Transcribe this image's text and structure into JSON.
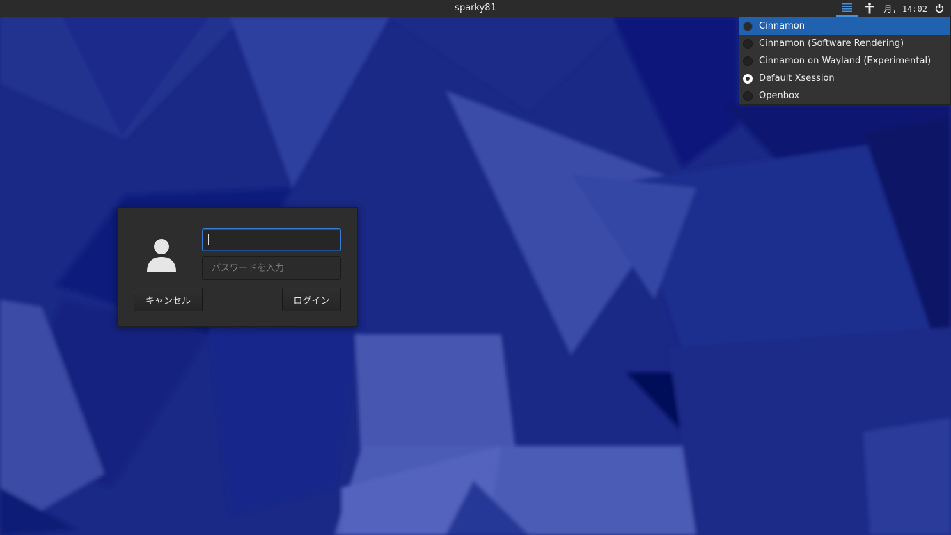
{
  "topbar": {
    "hostname": "sparky81",
    "clock": "月, 14:02",
    "session_icon": "session-list-icon",
    "accessibility_icon": "accessibility-icon",
    "power_icon": "power-icon",
    "accent_color": "#4a90d9"
  },
  "session_menu": {
    "items": [
      {
        "label": "Cinnamon",
        "selected": false,
        "highlighted": true
      },
      {
        "label": "Cinnamon (Software Rendering)",
        "selected": false,
        "highlighted": false
      },
      {
        "label": "Cinnamon on Wayland (Experimental)",
        "selected": false,
        "highlighted": false
      },
      {
        "label": "Default Xsession",
        "selected": true,
        "highlighted": false
      },
      {
        "label": "Openbox",
        "selected": false,
        "highlighted": false
      }
    ],
    "highlight_color": "#2162b0"
  },
  "login": {
    "avatar_icon": "user-avatar-icon",
    "username_value": "",
    "password_placeholder": "パスワードを入力",
    "cancel_label": "キャンセル",
    "login_label": "ログイン"
  },
  "colors": {
    "wallpaper_base": "#1b2a8a",
    "panel": "#2b2b2b",
    "dialog": "#2d2d2d"
  }
}
